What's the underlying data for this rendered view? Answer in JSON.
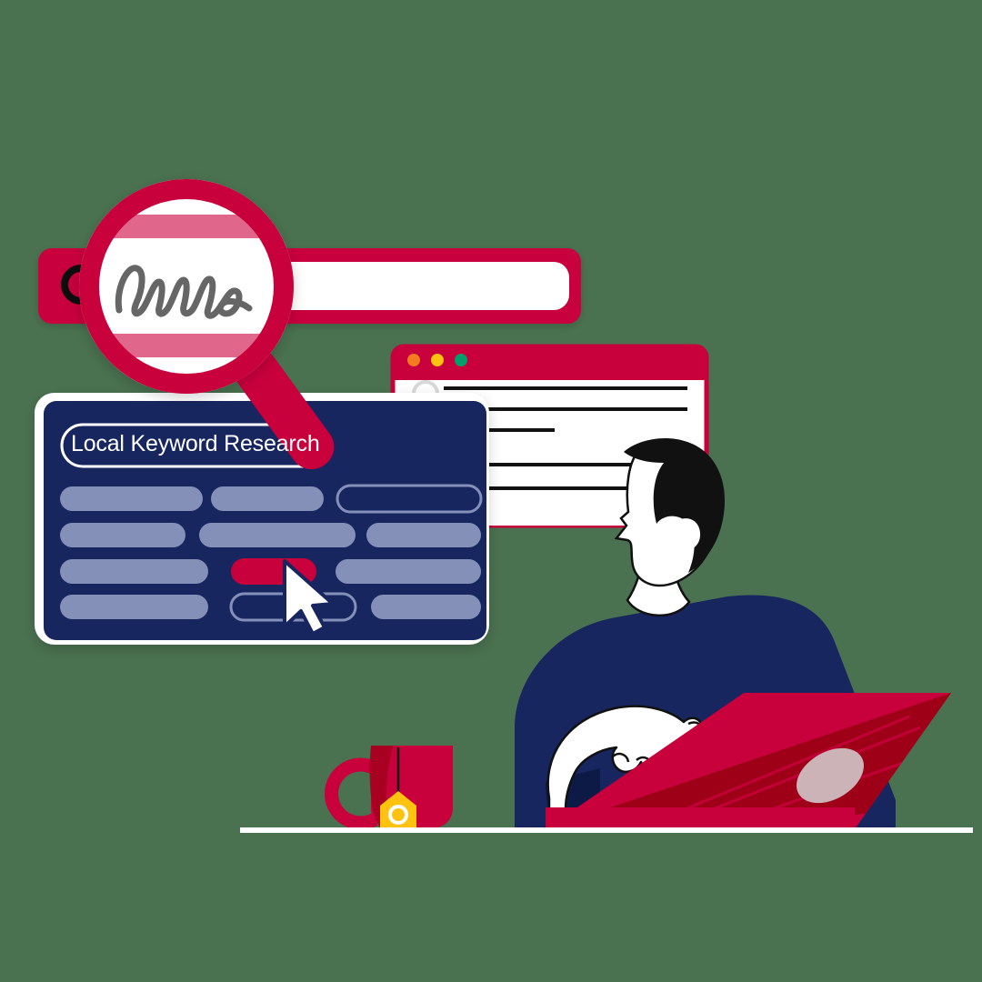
{
  "scene": {
    "title": "Local Keyword Research",
    "background_color": "#4a7150",
    "floor_line_color": "#ffffff"
  },
  "palette": {
    "crimson": "#c8003c",
    "crimson_dark": "#a80018",
    "navy": "#17265f",
    "navy_deep": "#0d1a45",
    "pill_blue": "#8490b8",
    "white": "#ffffff",
    "black": "#111111",
    "pink_tint": "#e0668c",
    "scribble_gray": "#666666",
    "tea_tag_yellow": "#ffc20e",
    "laptop_highlight": "#ccb3b8",
    "dot_orange": "#f57a20",
    "dot_yellow": "#ffc20e",
    "dot_green": "#00a06d"
  },
  "search_bar": {
    "name": "search-bar",
    "icon": "search-icon",
    "field_value": "",
    "field_placeholder": ""
  },
  "magnifier": {
    "name": "magnifier",
    "lens_content": "scribble-text",
    "scribble_label": "illegible handwriting squiggle"
  },
  "browser_window": {
    "name": "browser-window",
    "traffic_lights": [
      "#f57a20",
      "#ffc20e",
      "#00a06d"
    ],
    "avatar_placeholder": "circle-avatar-icon",
    "content_lines": 5
  },
  "keyword_panel": {
    "name": "keyword-panel",
    "title": "Local Keyword Research",
    "rows": [
      [
        {
          "style": "filled",
          "name": "keyword-pill"
        },
        {
          "style": "filled",
          "name": "keyword-pill"
        },
        {
          "style": "outline",
          "name": "keyword-pill-outline"
        }
      ],
      [
        {
          "style": "filled",
          "name": "keyword-pill"
        },
        {
          "style": "filled",
          "name": "keyword-pill"
        },
        {
          "style": "filled",
          "name": "keyword-pill"
        }
      ],
      [
        {
          "style": "filled",
          "name": "keyword-pill"
        },
        {
          "style": "selected",
          "name": "keyword-pill-selected"
        },
        {
          "style": "filled",
          "name": "keyword-pill"
        }
      ],
      [
        {
          "style": "filled",
          "name": "keyword-pill"
        },
        {
          "style": "outline",
          "name": "keyword-pill-outline"
        },
        {
          "style": "filled",
          "name": "keyword-pill"
        }
      ]
    ],
    "cursor": "mouse-cursor-arrow"
  },
  "person": {
    "name": "person-figure",
    "hair_color": "#111111",
    "shirt_color": "#17265f",
    "skin_color": "#ffffff"
  },
  "laptop": {
    "name": "laptop",
    "lid_color": "#c8003c",
    "lid_shadow_color": "#9e0018",
    "highlight": "screen-glare"
  },
  "mug": {
    "name": "coffee-mug",
    "body_color": "#c8003c",
    "tea_tag": {
      "name": "tea-bag-tag",
      "color": "#ffc20e",
      "ring_color": "#ffffff"
    }
  }
}
